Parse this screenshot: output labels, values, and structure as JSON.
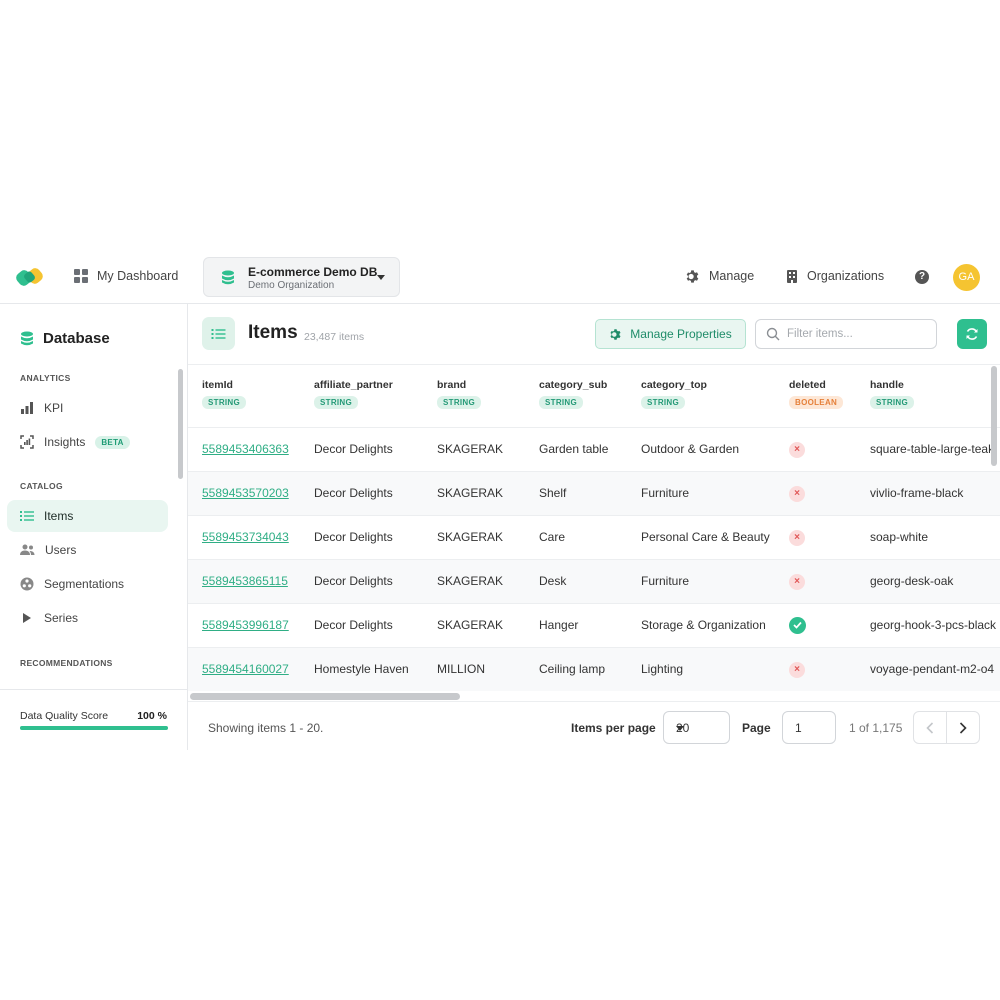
{
  "topbar": {
    "dashboard_label": "My Dashboard",
    "db_name": "E-commerce Demo DB",
    "db_org": "Demo Organization",
    "manage_label": "Manage",
    "organizations_label": "Organizations",
    "help_glyph": "?",
    "avatar_initials": "GA"
  },
  "sidebar": {
    "title": "Database",
    "sections": {
      "analytics": "ANALYTICS",
      "catalog": "CATALOG",
      "recommendations": "RECOMMENDATIONS"
    },
    "items": {
      "kpi": "KPI",
      "insights": "Insights",
      "insights_badge": "BETA",
      "items": "Items",
      "users": "Users",
      "segmentations": "Segmentations",
      "series": "Series"
    },
    "active_item": "Items",
    "quality_label": "Data Quality Score",
    "quality_value": "100 %",
    "quality_fraction": 1.0
  },
  "main": {
    "title": "Items",
    "count": "23,487 items",
    "manage_properties_label": "Manage Properties",
    "filter_placeholder": "Filter items..."
  },
  "table": {
    "columns": [
      {
        "name": "itemId",
        "type": "STRING"
      },
      {
        "name": "affiliate_partner",
        "type": "STRING"
      },
      {
        "name": "brand",
        "type": "STRING"
      },
      {
        "name": "category_sub",
        "type": "STRING"
      },
      {
        "name": "category_top",
        "type": "STRING"
      },
      {
        "name": "deleted",
        "type": "BOOLEAN"
      },
      {
        "name": "handle",
        "type": "STRING"
      }
    ],
    "rows": [
      {
        "itemId": "5589453406363",
        "affiliate_partner": "Decor Delights",
        "brand": "SKAGERAK",
        "category_sub": "Garden table",
        "category_top": "Outdoor & Garden",
        "deleted": false,
        "handle": "square-table-large-teak"
      },
      {
        "itemId": "5589453570203",
        "affiliate_partner": "Decor Delights",
        "brand": "SKAGERAK",
        "category_sub": "Shelf",
        "category_top": "Furniture",
        "deleted": false,
        "handle": "vivlio-frame-black"
      },
      {
        "itemId": "5589453734043",
        "affiliate_partner": "Decor Delights",
        "brand": "SKAGERAK",
        "category_sub": "Care",
        "category_top": "Personal Care & Beauty",
        "deleted": false,
        "handle": "soap-white"
      },
      {
        "itemId": "5589453865115",
        "affiliate_partner": "Decor Delights",
        "brand": "SKAGERAK",
        "category_sub": "Desk",
        "category_top": "Furniture",
        "deleted": false,
        "handle": "georg-desk-oak"
      },
      {
        "itemId": "5589453996187",
        "affiliate_partner": "Decor Delights",
        "brand": "SKAGERAK",
        "category_sub": "Hanger",
        "category_top": "Storage & Organization",
        "deleted": true,
        "handle": "georg-hook-3-pcs-black"
      },
      {
        "itemId": "5589454160027",
        "affiliate_partner": "Homestyle Haven",
        "brand": "MILLION",
        "category_sub": "Ceiling lamp",
        "category_top": "Lighting",
        "deleted": false,
        "handle": "voyage-pendant-m2-o4"
      }
    ]
  },
  "footer": {
    "showing": "Showing items 1 - 20.",
    "items_per_page_label": "Items per page",
    "items_per_page_value": "20",
    "page_label": "Page",
    "page_value": "1",
    "page_of": "1 of 1,175"
  },
  "colors": {
    "accent": "#2fbf8f",
    "accent_light": "#e9f6f1",
    "avatar": "#f5c431",
    "boolean_badge": "#fde7d6",
    "error": "#e05656"
  }
}
